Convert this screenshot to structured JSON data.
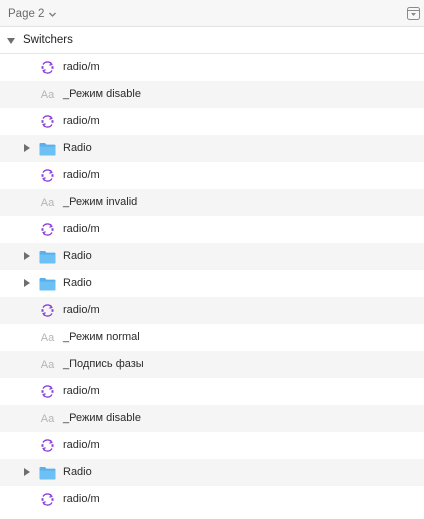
{
  "header": {
    "page_label": "Page 2",
    "selector_icon": "chevron-down-icon",
    "right_icon": "collapse-panel-icon"
  },
  "group": {
    "label": "Switchers",
    "expanded": true
  },
  "colors": {
    "symbol_purple": "#8b3fd9",
    "folder_blue": "#5ab0ec",
    "text_icon_gray": "#b5b5b5",
    "row_alt": "#f5f5f5"
  },
  "layers": [
    {
      "type": "symbol",
      "icon": "symbol-instance-icon",
      "label": "radio/m",
      "has_expander": false
    },
    {
      "type": "text",
      "icon": "text-layer-icon",
      "icon_text": "Aa",
      "label": "_Режим disable",
      "has_expander": false
    },
    {
      "type": "symbol",
      "icon": "symbol-instance-icon",
      "label": "radio/m",
      "has_expander": false
    },
    {
      "type": "folder",
      "icon": "folder-icon",
      "label": "Radio",
      "has_expander": true
    },
    {
      "type": "symbol",
      "icon": "symbol-instance-icon",
      "label": "radio/m",
      "has_expander": false
    },
    {
      "type": "text",
      "icon": "text-layer-icon",
      "icon_text": "Aa",
      "label": "_Режим invalid",
      "has_expander": false
    },
    {
      "type": "symbol",
      "icon": "symbol-instance-icon",
      "label": "radio/m",
      "has_expander": false
    },
    {
      "type": "folder",
      "icon": "folder-icon",
      "label": "Radio",
      "has_expander": true
    },
    {
      "type": "folder",
      "icon": "folder-icon",
      "label": "Radio",
      "has_expander": true
    },
    {
      "type": "symbol",
      "icon": "symbol-instance-icon",
      "label": "radio/m",
      "has_expander": false
    },
    {
      "type": "text",
      "icon": "text-layer-icon",
      "icon_text": "Aa",
      "label": "_Режим normal",
      "has_expander": false
    },
    {
      "type": "text",
      "icon": "text-layer-icon",
      "icon_text": "Aa",
      "label": "_Подпись фазы",
      "has_expander": false
    },
    {
      "type": "symbol",
      "icon": "symbol-instance-icon",
      "label": "radio/m",
      "has_expander": false
    },
    {
      "type": "text",
      "icon": "text-layer-icon",
      "icon_text": "Aa",
      "label": "_Режим disable",
      "has_expander": false
    },
    {
      "type": "symbol",
      "icon": "symbol-instance-icon",
      "label": "radio/m",
      "has_expander": false
    },
    {
      "type": "folder",
      "icon": "folder-icon",
      "label": "Radio",
      "has_expander": true
    },
    {
      "type": "symbol",
      "icon": "symbol-instance-icon",
      "label": "radio/m",
      "has_expander": false
    }
  ]
}
